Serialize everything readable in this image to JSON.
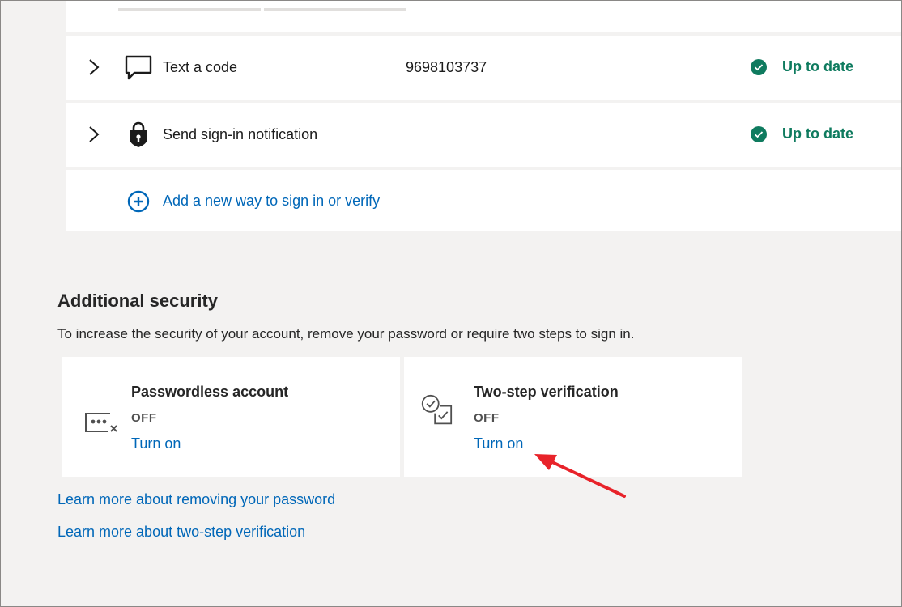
{
  "colors": {
    "background": "#f3f2f1",
    "card": "#ffffff",
    "link": "#0067b8",
    "success": "#0f7b5f",
    "annotation_arrow": "#e8232a"
  },
  "sign_in_methods": [
    {
      "icon": "speech-bubble-icon",
      "label": "Text a code",
      "value": "9698103737",
      "status": "Up to date"
    },
    {
      "icon": "lock-shield-icon",
      "label": "Send sign-in notification",
      "value": "",
      "status": "Up to date"
    }
  ],
  "add_method": {
    "icon": "plus-circle-icon",
    "label": "Add a new way to sign in or verify"
  },
  "additional_security": {
    "title": "Additional security",
    "description": "To increase the security of your account, remove your password or require two steps to sign in.",
    "cards": [
      {
        "icon": "password-dots-icon",
        "title": "Passwordless account",
        "state": "OFF",
        "action": "Turn on"
      },
      {
        "icon": "two-step-check-icon",
        "title": "Two-step verification",
        "state": "OFF",
        "action": "Turn on"
      }
    ],
    "links": [
      "Learn more about removing your password",
      "Learn more about two-step verification"
    ]
  }
}
